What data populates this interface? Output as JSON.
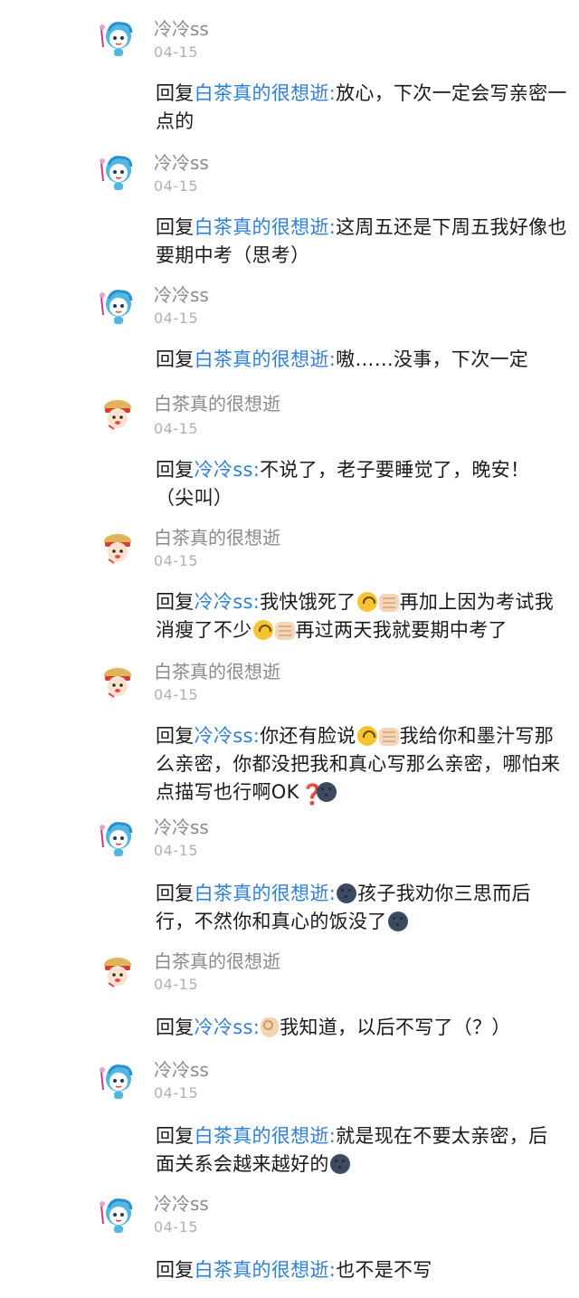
{
  "users": {
    "lengleng": "冷冷ss",
    "baicha": "白茶真的很想逝"
  },
  "replies": [
    {
      "user": "冷冷ss",
      "time": "04-15",
      "prefix": "回复",
      "target": "白茶真的很想逝",
      "sep": ":",
      "body": [
        "放心，下次一定会写亲密一点的"
      ]
    },
    {
      "user": "冷冷ss",
      "time": "04-15",
      "prefix": "回复",
      "target": "白茶真的很想逝",
      "sep": ":",
      "body": [
        "这周五还是下周五我好像也要期中考（思考）"
      ]
    },
    {
      "user": "冷冷ss",
      "time": "04-15",
      "prefix": "回复",
      "target": "白茶真的很想逝",
      "sep": ":",
      "body": [
        "嗷……没事，下次一定"
      ]
    },
    {
      "user": "白茶真的很想逝",
      "time": "04-15",
      "prefix": "回复",
      "target": "冷冷ss",
      "sep": ":",
      "body": [
        "不说了，老子要睡觉了，晚安！（尖叫）"
      ]
    },
    {
      "user": "白茶真的很想逝",
      "time": "04-15",
      "prefix": "回复",
      "target": "冷冷ss",
      "sep": ":",
      "body": [
        "我快饿死了",
        "再加上因为考试我消瘦了不少",
        "再过两天我就要期中考了"
      ]
    },
    {
      "user": "白茶真的很想逝",
      "time": "04-15",
      "prefix": "回复",
      "target": "冷冷ss",
      "sep": ":",
      "body": [
        "你还有脸说",
        "我给你和墨汁写那么亲密，你都没把我和真心写那么亲密，哪怕来点描写也行啊OK"
      ]
    },
    {
      "user": "冷冷ss",
      "time": "04-15",
      "prefix": "回复",
      "target": "白茶真的很想逝",
      "sep": ":",
      "body": [
        "孩子我劝你三思而后行，不然你和真心的饭没了"
      ]
    },
    {
      "user": "白茶真的很想逝",
      "time": "04-15",
      "prefix": "回复",
      "target": "冷冷ss",
      "sep": ":",
      "body": [
        "我知道，以后不写了（？）"
      ]
    },
    {
      "user": "冷冷ss",
      "time": "04-15",
      "prefix": "回复",
      "target": "白茶真的很想逝",
      "sep": ":",
      "body": [
        "就是现在不要太亲密，后面关系会越来越好的"
      ]
    },
    {
      "user": "冷冷ss",
      "time": "04-15",
      "prefix": "回复",
      "target": "白茶真的很想逝",
      "sep": ":",
      "body": [
        "也不是不写"
      ]
    }
  ],
  "icons": {
    "avatar_lengleng": "blue-cartoon-avatar-icon",
    "avatar_baicha": "red-hat-cartoon-avatar-icon",
    "upside_down": "upside-down-face-icon",
    "fist": "fist-emoji-icon",
    "moon": "new-moon-face-icon",
    "ok": "ok-hand-icon",
    "question": "red-question-mark-icon"
  },
  "colors": {
    "link": "#2f7fd8",
    "name": "#8a8a8a",
    "time": "#b0b0b0",
    "text": "#1a1a1a"
  }
}
